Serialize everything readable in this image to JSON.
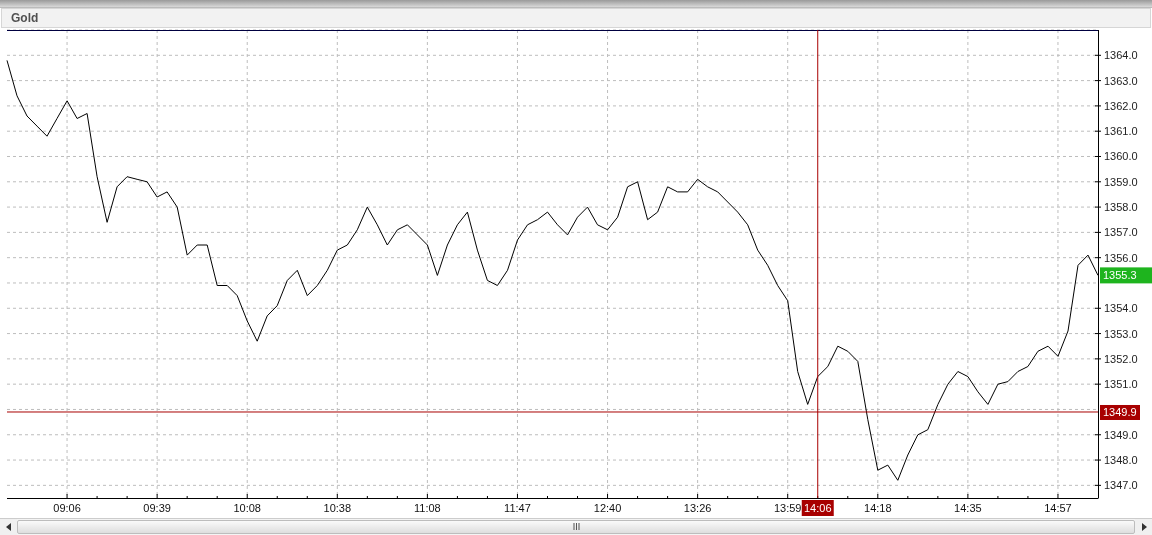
{
  "panel": {
    "title": "Gold"
  },
  "chart": {
    "chart_data": {
      "type": "line",
      "categories": [
        null,
        null,
        null,
        null,
        null,
        null,
        "09:06",
        null,
        null,
        null,
        null,
        null,
        null,
        null,
        null,
        "09:39",
        null,
        null,
        null,
        null,
        null,
        null,
        null,
        null,
        "10:08",
        null,
        null,
        null,
        null,
        null,
        null,
        null,
        null,
        "10:38",
        null,
        null,
        null,
        null,
        null,
        null,
        null,
        null,
        "11:08",
        null,
        null,
        null,
        null,
        null,
        null,
        null,
        null,
        "11:47",
        null,
        null,
        null,
        null,
        null,
        null,
        null,
        null,
        "12:40",
        null,
        null,
        null,
        null,
        null,
        null,
        null,
        null,
        "13:26",
        null,
        null,
        null,
        null,
        null,
        null,
        null,
        null,
        "13:59",
        null,
        null,
        "14:06",
        null,
        null,
        null,
        null,
        null,
        "14:18",
        null,
        null,
        null,
        null,
        null,
        null,
        null,
        null,
        "14:35",
        null,
        null,
        null,
        null,
        null,
        null,
        null,
        null,
        "14:57",
        null,
        null,
        null,
        null
      ],
      "series": [
        {
          "color": "#000000",
          "values": [
            1363.8,
            1362.4,
            1361.6,
            1361.2,
            1360.8,
            1361.5,
            1362.2,
            1361.5,
            1361.7,
            1359.2,
            1357.4,
            1358.8,
            1359.2,
            1359.1,
            1359.0,
            1358.4,
            1358.6,
            1358.0,
            1356.1,
            1356.5,
            1356.5,
            1354.9,
            1354.9,
            1354.5,
            1353.5,
            1352.7,
            1353.7,
            1354.1,
            1355.1,
            1355.5,
            1354.5,
            1354.9,
            1355.5,
            1356.3,
            1356.5,
            1357.1,
            1358.0,
            1357.3,
            1356.5,
            1357.1,
            1357.3,
            1356.9,
            1356.5,
            1355.3,
            1356.5,
            1357.3,
            1357.8,
            1356.3,
            1355.1,
            1354.9,
            1355.5,
            1356.7,
            1357.3,
            1357.5,
            1357.8,
            1357.3,
            1356.9,
            1357.6,
            1358.0,
            1357.3,
            1357.1,
            1357.6,
            1358.8,
            1359.0,
            1357.5,
            1357.8,
            1358.8,
            1358.6,
            1358.6,
            1359.1,
            1358.8,
            1358.6,
            1358.2,
            1357.8,
            1357.3,
            1356.3,
            1355.7,
            1354.9,
            1354.3,
            1351.5,
            1350.2,
            1351.3,
            1351.7,
            1352.5,
            1352.3,
            1351.9,
            1349.6,
            1347.6,
            1347.8,
            1347.2,
            1348.2,
            1349.0,
            1349.2,
            1350.2,
            1351.0,
            1351.5,
            1351.3,
            1350.7,
            1350.2,
            1351.0,
            1351.1,
            1351.5,
            1351.7,
            1352.3,
            1352.5,
            1352.1,
            1353.1,
            1355.7,
            1356.1,
            1355.3
          ]
        }
      ],
      "ylim": [
        1346.5,
        1365
      ],
      "grid": true,
      "yticks": [
        {
          "value": 1347,
          "label": "1347.0"
        },
        {
          "value": 1348,
          "label": "1348.0"
        },
        {
          "value": 1349,
          "label": "1349.0"
        },
        {
          "value": 1351,
          "label": "1351.0"
        },
        {
          "value": 1352,
          "label": "1352.0"
        },
        {
          "value": 1353,
          "label": "1353.0"
        },
        {
          "value": 1354,
          "label": "1354.0"
        },
        {
          "value": 1356,
          "label": "1356.0"
        },
        {
          "value": 1357,
          "label": "1357.0"
        },
        {
          "value": 1358,
          "label": "1358.0"
        },
        {
          "value": 1359,
          "label": "1359.0"
        },
        {
          "value": 1360,
          "label": "1360.0"
        },
        {
          "value": 1361,
          "label": "1361.0"
        },
        {
          "value": 1362,
          "label": "1362.0"
        },
        {
          "value": 1363,
          "label": "1363.0"
        },
        {
          "value": 1364,
          "label": "1364.0"
        }
      ],
      "ref_lines": [
        {
          "axis": "x",
          "value": "14:06",
          "color": "#a80000"
        },
        {
          "axis": "y",
          "value": 1349.9,
          "label": "1349.9",
          "color": "#a80000"
        }
      ],
      "annotations": [
        "1355.3"
      ]
    }
  }
}
